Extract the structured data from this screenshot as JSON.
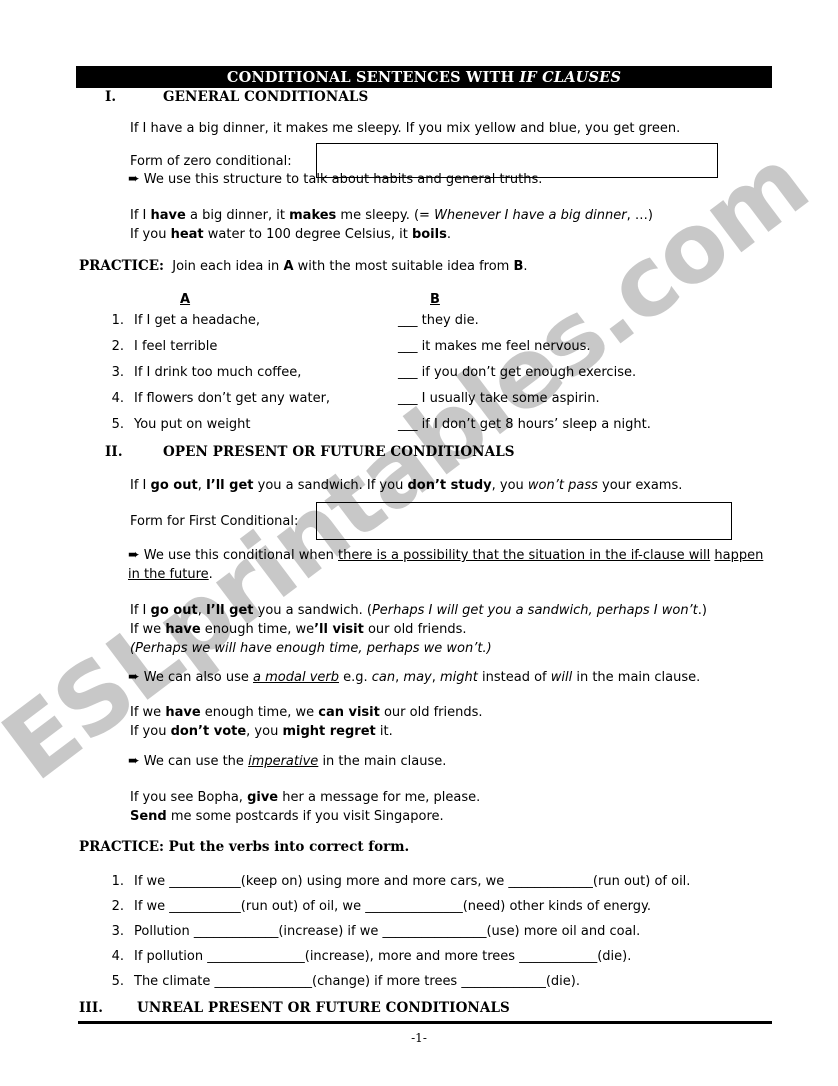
{
  "document": {
    "title_main": "CONDITIONAL SENTENCES WITH",
    "title_italic": "IF CLAUSES",
    "page_number": "-1-",
    "watermark": "ESLprintables.com",
    "arrow_glyph": "➨"
  },
  "sections": {
    "one": {
      "numeral": "I.",
      "heading": "GENERAL CONDITIONALS",
      "examples_line": "If I have a big dinner, it makes me sleepy.    If you mix yellow and blue, you get green.",
      "form_label": "Form of zero conditional:",
      "rule": "We use this structure to talk about habits and general truths.",
      "ex1_a": "If I ",
      "ex1_b1": "have",
      "ex1_c": " a big dinner, it ",
      "ex1_b2": "makes",
      "ex1_d": " me sleepy. (= ",
      "ex1_i": "Whenever I have a big dinner",
      "ex1_e": ", …)",
      "ex2_a": "If you ",
      "ex2_b1": "heat",
      "ex2_c": " water to 100 degree Celsius, it ",
      "ex2_b2": "boils",
      "ex2_d": "."
    },
    "practice1": {
      "label": "PRACTICE:",
      "instruction": "Join each idea in A with the most suitable idea from B.",
      "col_a": "A",
      "col_b": "B",
      "rows": [
        {
          "num": "1.",
          "a": "If I get a headache,",
          "b": "___  they die."
        },
        {
          "num": "2.",
          "a": "I feel terrible",
          "b": "___  it makes me feel nervous."
        },
        {
          "num": "3.",
          "a": "If I drink too much coffee,",
          "b": "___  if you don’t get enough exercise."
        },
        {
          "num": "4.",
          "a": "If flowers don’t get any water,",
          "b": "___  I usually take some aspirin."
        },
        {
          "num": "5.",
          "a": "You put on weight",
          "b": "___  if I don’t get 8 hours’ sleep a night."
        }
      ]
    },
    "two": {
      "numeral": "II.",
      "heading": "OPEN PRESENT OR FUTURE CONDITIONALS",
      "ex_lead_1": "If I ",
      "ex_lead_b1": "go out",
      "ex_lead_2": ", ",
      "ex_lead_b2": "I’ll get",
      "ex_lead_3": " you a sandwich.      If you ",
      "ex_lead_b3": "don’t study",
      "ex_lead_4": ", you ",
      "ex_lead_i": "won’t pass",
      "ex_lead_5": " your exams.",
      "form_label": "Form for First Conditional:",
      "rule_plain": "We use this conditional when ",
      "rule_underline_1": "there is a possibility that the situation in the if-clause will",
      "rule_underline_2": "happen in the future",
      "rule_period": ".",
      "ex_a1": "If I ",
      "ex_a_b1": "go out",
      "ex_a2": ", ",
      "ex_a_b2": "I’ll get",
      "ex_a3": " you a sandwich. (",
      "ex_a_i": "Perhaps I will get you a sandwich, perhaps I won’t",
      "ex_a4": ".)",
      "ex_b1": "If we ",
      "ex_b_b1": "have",
      "ex_b2": " enough time, we",
      "ex_b_b2": "’ll visit",
      "ex_b3": " our old friends.",
      "ex_c_i": "(Perhaps we will have enough time, perhaps we won’t.)",
      "rule2_a": "We can also use ",
      "rule2_u": "a modal verb",
      "rule2_b": " e.g. ",
      "rule2_i1": "can",
      "rule2_c": ", ",
      "rule2_i2": "may",
      "rule2_d": ", ",
      "rule2_i3": "might",
      "rule2_e": " instead of ",
      "rule2_i4": "will",
      "rule2_f": " in the main clause.",
      "ex_d1": "If we ",
      "ex_d_b1": "have",
      "ex_d2": " enough time, we ",
      "ex_d_b2": "can visit",
      "ex_d3": " our old friends.",
      "ex_e1": "If you ",
      "ex_e_b1": "don’t vote",
      "ex_e2": ", you ",
      "ex_e_b2": "might regret",
      "ex_e3": " it.",
      "rule3_a": "We can use the ",
      "rule3_u": "imperative",
      "rule3_b": " in the main clause.",
      "ex_f1": "If you see Bopha, ",
      "ex_f_b": "give",
      "ex_f2": " her a message for me, please.",
      "ex_g_b": "Send",
      "ex_g1": " me some postcards if you visit Singapore."
    },
    "practice2": {
      "label": "PRACTICE:",
      "instruction": "Put the verbs into correct form.",
      "rows": [
        {
          "num": "1.",
          "text": "If we ___________(keep on) using more and more cars, we _____________(run out) of oil."
        },
        {
          "num": "2.",
          "text": "If we ___________(run out) of oil, we _______________(need) other kinds of energy."
        },
        {
          "num": "3.",
          "text": "Pollution _____________(increase) if we ________________(use) more oil and coal."
        },
        {
          "num": "4.",
          "text": "If pollution _______________(increase), more and more trees ____________(die)."
        },
        {
          "num": "5.",
          "text": "The climate _______________(change) if more trees _____________(die)."
        }
      ]
    },
    "three": {
      "numeral": "III.",
      "heading": "UNREAL PRESENT OR FUTURE CONDITIONALS"
    }
  }
}
